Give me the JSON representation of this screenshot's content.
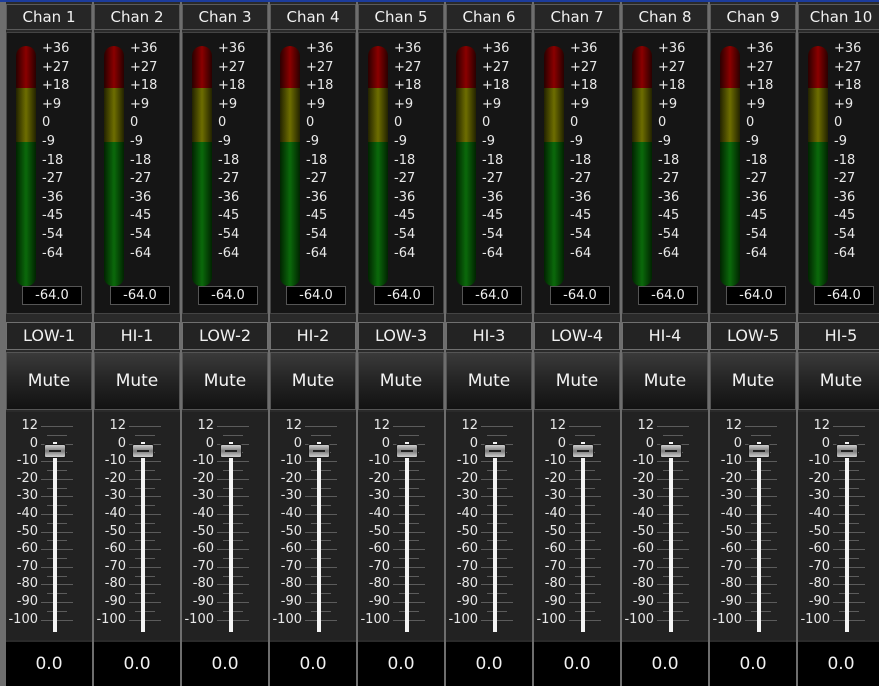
{
  "mixer": {
    "meter_scale": [
      "+36",
      "+27",
      "+18",
      "+9",
      "0",
      "-9",
      "-18",
      "-27",
      "-36",
      "-45",
      "-54",
      "-64"
    ],
    "fader_scale": [
      "12",
      "0",
      "-10",
      "-20",
      "-30",
      "-40",
      "-50",
      "-60",
      "-70",
      "-80",
      "-90",
      "-100"
    ],
    "colors": {
      "meter_red": "#8b0000",
      "meter_yellow": "#6e6e00",
      "meter_green": "#0b6a0b",
      "header_accent": "#1c3c9c"
    },
    "channels": [
      {
        "name": "Chan 1",
        "band": "LOW-1",
        "mute_label": "Mute",
        "meter_value": "-64.0",
        "gain_value": "0.0"
      },
      {
        "name": "Chan 2",
        "band": "HI-1",
        "mute_label": "Mute",
        "meter_value": "-64.0",
        "gain_value": "0.0"
      },
      {
        "name": "Chan 3",
        "band": "LOW-2",
        "mute_label": "Mute",
        "meter_value": "-64.0",
        "gain_value": "0.0"
      },
      {
        "name": "Chan 4",
        "band": "HI-2",
        "mute_label": "Mute",
        "meter_value": "-64.0",
        "gain_value": "0.0"
      },
      {
        "name": "Chan 5",
        "band": "LOW-3",
        "mute_label": "Mute",
        "meter_value": "-64.0",
        "gain_value": "0.0"
      },
      {
        "name": "Chan 6",
        "band": "HI-3",
        "mute_label": "Mute",
        "meter_value": "-64.0",
        "gain_value": "0.0"
      },
      {
        "name": "Chan 7",
        "band": "LOW-4",
        "mute_label": "Mute",
        "meter_value": "-64.0",
        "gain_value": "0.0"
      },
      {
        "name": "Chan 8",
        "band": "HI-4",
        "mute_label": "Mute",
        "meter_value": "-64.0",
        "gain_value": "0.0"
      },
      {
        "name": "Chan 9",
        "band": "LOW-5",
        "mute_label": "Mute",
        "meter_value": "-64.0",
        "gain_value": "0.0"
      },
      {
        "name": "Chan 10",
        "band": "HI-5",
        "mute_label": "Mute",
        "meter_value": "-64.0",
        "gain_value": "0.0"
      }
    ]
  }
}
